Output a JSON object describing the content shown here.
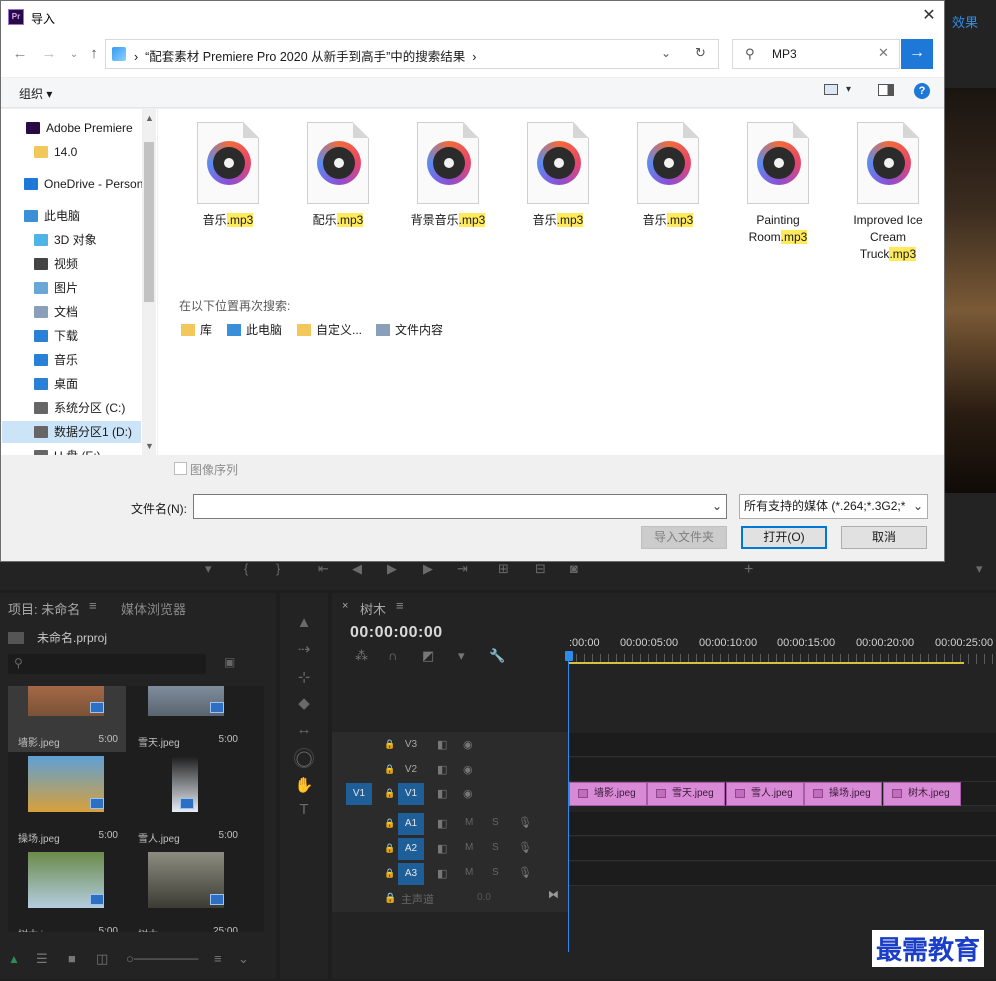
{
  "dialog": {
    "title": "导入",
    "address_path": "“配套素材 Premiere Pro 2020 从新手到高手”中的搜索结果",
    "search_value": "MP3",
    "organize_label": "组织 ▾",
    "nav_items": [
      {
        "label": "Adobe Premiere",
        "icon": "premiere-icon"
      },
      {
        "label": "14.0",
        "icon": "folder-icon"
      },
      {
        "label": "OneDrive - Personal",
        "icon": "onedrive-icon"
      },
      {
        "label": "此电脑",
        "icon": "pc-icon"
      },
      {
        "label": "3D 对象",
        "icon": "3d-objects-icon"
      },
      {
        "label": "视频",
        "icon": "video-icon"
      },
      {
        "label": "图片",
        "icon": "pictures-icon"
      },
      {
        "label": "文档",
        "icon": "documents-icon"
      },
      {
        "label": "下载",
        "icon": "download-icon"
      },
      {
        "label": "音乐",
        "icon": "music-icon"
      },
      {
        "label": "桌面",
        "icon": "desktop-icon"
      },
      {
        "label": "系统分区 (C:)",
        "icon": "drive-icon"
      },
      {
        "label": "数据分区1 (D:)",
        "icon": "drive-icon"
      },
      {
        "label": "U 盘 (E:)",
        "icon": "drive-icon"
      }
    ],
    "files": [
      {
        "name_lines": [
          "音乐"
        ],
        "ext": ".mp3"
      },
      {
        "name_lines": [
          "配乐"
        ],
        "ext": ".mp3"
      },
      {
        "name_lines": [
          "背景音乐"
        ],
        "ext": ".mp3"
      },
      {
        "name_lines": [
          "音乐"
        ],
        "ext": ".mp3"
      },
      {
        "name_lines": [
          "音乐"
        ],
        "ext": ".mp3"
      },
      {
        "name_lines": [
          "Painting",
          "Room"
        ],
        "ext": ".mp3"
      },
      {
        "name_lines": [
          "Improved Ice",
          "Cream",
          "Truck"
        ],
        "ext": ".mp3"
      }
    ],
    "search_again_label": "在以下位置再次搜索:",
    "search_again_items": [
      "库",
      "此电脑",
      "自定义...",
      "文件内容"
    ],
    "image_sequence_label": "图像序列",
    "filename_label": "文件名(N):",
    "filename_value": "",
    "filetype_value": "所有支持的媒体 (*.264;*.3G2;*",
    "import_folder_label": "导入文件夹",
    "open_label": "打开(O)",
    "cancel_label": "取消"
  },
  "premiere": {
    "effects_tab": "效果",
    "project_tab": "项目: 未命名",
    "media_browser_tab": "媒体浏览器",
    "project_file": "未命名.prproj",
    "clips": [
      {
        "name": "墙影.jpeg",
        "dur": "5:00",
        "colors": [
          "#c97c55",
          "#7a5236"
        ]
      },
      {
        "name": "雪天.jpeg",
        "dur": "5:00",
        "colors": [
          "#9fb0c2",
          "#5a6470"
        ]
      },
      {
        "name": "操场.jpeg",
        "dur": "5:00",
        "colors": [
          "#5ea0d6",
          "#d8a03a"
        ]
      },
      {
        "name": "雪人.jpeg",
        "dur": "5:00",
        "colors": [
          "#1c1c1c",
          "#e8eef4"
        ]
      },
      {
        "name": "树木.jpeg",
        "dur": "5:00",
        "colors": [
          "#6a8a4a",
          "#b4cde0"
        ]
      },
      {
        "name": "树木",
        "dur": "25:00",
        "colors": [
          "#8c8c80",
          "#3c3c34"
        ]
      }
    ],
    "sequence_tab": "树木",
    "timecode": "00:00:00:00",
    "ruler_labels": [
      ":00:00",
      "00:00:05:00",
      "00:00:10:00",
      "00:00:15:00",
      "00:00:20:00",
      "00:00:25:00"
    ],
    "video_tracks": [
      "V3",
      "V2",
      "V1"
    ],
    "audio_tracks": [
      "A1",
      "A2",
      "A3"
    ],
    "source_patch": "V1",
    "master_label": "主声道",
    "master_value": "0.0",
    "mute_label": "M",
    "solo_label": "S",
    "timeline_clips": [
      "墙影.jpeg",
      "雪天.jpeg",
      "雪人.jpeg",
      "操场.jpeg",
      "树木.jpeg"
    ]
  },
  "watermark": "最需教育"
}
